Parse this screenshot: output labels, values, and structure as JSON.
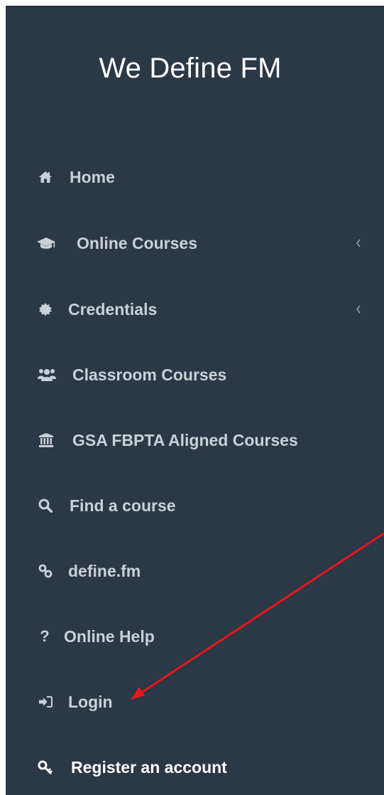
{
  "sidebar": {
    "brand": "We Define FM",
    "items": [
      {
        "label": "Home",
        "icon": "home-icon"
      },
      {
        "label": "Online Courses",
        "icon": "graduation-cap-icon",
        "has_submenu": true
      },
      {
        "label": "Credentials",
        "icon": "certificate-icon",
        "has_submenu": true
      },
      {
        "label": "Classroom Courses",
        "icon": "users-icon"
      },
      {
        "label": "GSA FBPTA Aligned Courses",
        "icon": "institution-icon"
      },
      {
        "label": "Find a course",
        "icon": "search-icon"
      },
      {
        "label": "define.fm",
        "icon": "link-icon"
      },
      {
        "label": "Online Help",
        "icon": "question-icon"
      },
      {
        "label": "Login",
        "icon": "sign-in-icon"
      },
      {
        "label": "Register an account",
        "icon": "key-icon",
        "active": true
      }
    ]
  },
  "annotation": {
    "color": "#e8161b"
  },
  "colors": {
    "sidebar_bg": "#2b3846",
    "text": "#c9d1d8",
    "active_text": "#ffffff"
  }
}
